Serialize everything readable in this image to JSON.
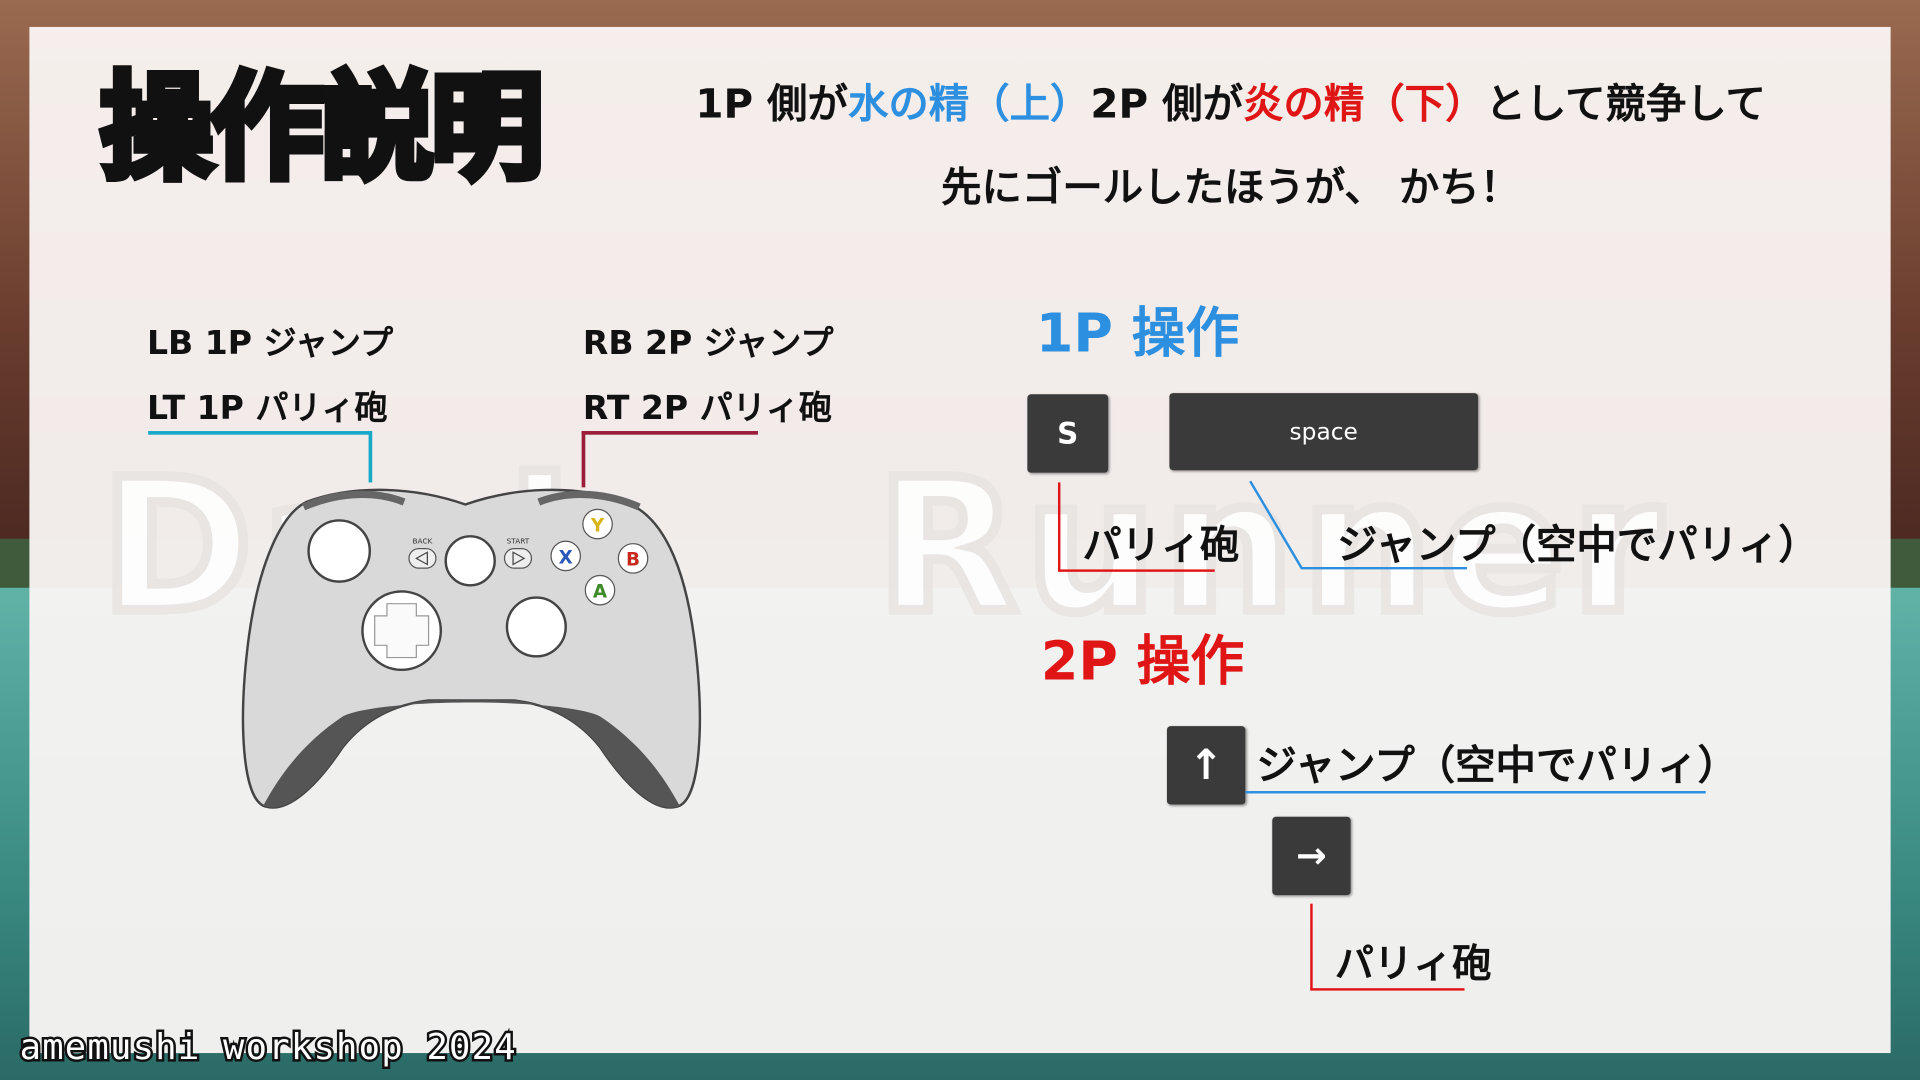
{
  "title": "操作説明",
  "intro": {
    "line1_a": "1P 側が",
    "line1_water": "水の精（上）",
    "line1_b": "2P 側が",
    "line1_fire": "炎の精（下）",
    "line1_c": "として競争して",
    "line2": "先にゴールしたほうが、 かち！"
  },
  "watermark": {
    "word1": "Dash",
    "word2": "Runner"
  },
  "controller": {
    "lb_label": "LB 1P ジャンプ",
    "lt_label": "LT 1P パリィ砲",
    "rb_label": "RB 2P ジャンプ",
    "rt_label": "RT 2P パリィ砲",
    "back": "BACK",
    "start": "START",
    "btn_y": "Y",
    "btn_x": "X",
    "btn_b": "B",
    "btn_a": "A"
  },
  "p1": {
    "heading": "1P 操作",
    "key_s": "S",
    "key_space": "space",
    "parry_label": "パリィ砲",
    "jump_label": "ジャンプ（空中でパリィ）"
  },
  "p2": {
    "heading": "2P 操作",
    "key_up": "↑",
    "key_right": "→",
    "jump_label": "ジャンプ（空中でパリィ）",
    "parry_label": "パリィ砲"
  },
  "footer": "amemushi workshop 2024",
  "colors": {
    "blue": "#2d8fe0",
    "red": "#e01616",
    "cyan_line": "#1aa8c8",
    "maroon_line": "#9a1e3a",
    "key_bg": "#3a3a3a"
  }
}
